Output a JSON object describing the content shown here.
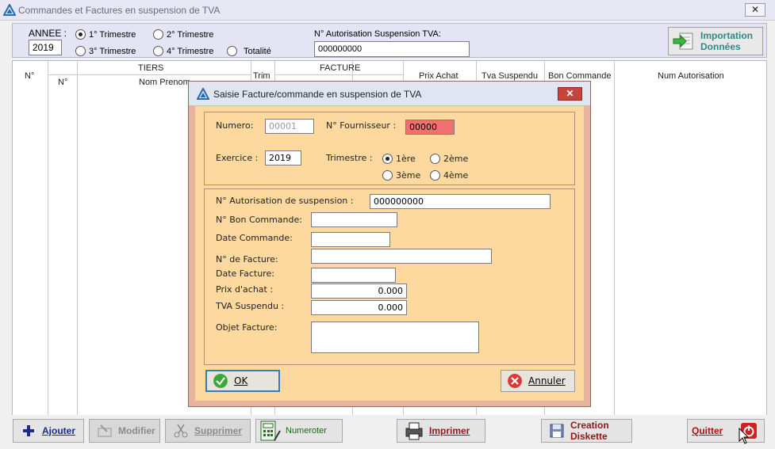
{
  "window": {
    "title": "Commandes et Factures en suspension de TVA",
    "close": "✕"
  },
  "filters": {
    "annee_label": "ANNEE :",
    "annee_value": "2019",
    "trimestres": [
      {
        "label": "1° Trimestre",
        "checked": true
      },
      {
        "label": "2° Trimestre",
        "checked": false
      },
      {
        "label": "3° Trimestre",
        "checked": false
      },
      {
        "label": "4° Trimestre",
        "checked": false
      },
      {
        "label": "Totalité",
        "checked": false
      }
    ],
    "auth_label": "N° Autorisation Suspension TVA:",
    "auth_value": "000000000",
    "import_line1": "Importation",
    "import_line2": "Données"
  },
  "grid": {
    "headers": {
      "num": "N°",
      "tiers": "TIERS",
      "tiers_num": "N°",
      "tiers_name": "Nom Prenom",
      "trim": "Trim",
      "facture": "FACTURE",
      "prix_achat": "Prix Achat",
      "tva_suspendu": "Tva Suspendu",
      "bon_commande": "Bon Commande",
      "num_autorisation": "Num Autorisation"
    }
  },
  "toolbar": {
    "ajouter": "Ajouter",
    "modifier": "Modifier",
    "supprimer": "Supprimer",
    "numeroter": "Numeroter",
    "imprimer": "Imprimer",
    "creation_line1": "Creation",
    "creation_line2": "Diskette",
    "quitter": "Quitter"
  },
  "dialog": {
    "title": "Saisie Facture/commande en suspension de TVA",
    "close": "✕",
    "numero_label": "Numero:",
    "numero_value": "00001",
    "fournisseur_label": "N° Fournisseur :",
    "fournisseur_value": "00000",
    "exercice_label": "Exercice  :",
    "exercice_value": "2019",
    "trimestre_label": "Trimestre :",
    "trimestres": [
      {
        "label": "1ère",
        "checked": true
      },
      {
        "label": "2ème",
        "checked": false
      },
      {
        "label": "3ème",
        "checked": false
      },
      {
        "label": "4ème",
        "checked": false
      }
    ],
    "autorisation_label": "N° Autorisation de suspension :",
    "autorisation_value": "000000000",
    "bon_commande_label": "N° Bon Commande:",
    "bon_commande_value": "",
    "date_commande_label": "Date Commande:",
    "date_commande_value": "",
    "facture_label": "N° de  Facture:",
    "facture_value": "",
    "date_facture_label": "Date Facture:",
    "date_facture_value": "",
    "prix_achat_label": "Prix d'achat :",
    "prix_achat_value": "0.000",
    "tva_label": "TVA Suspendu :",
    "tva_value": "0.000",
    "objet_label": "Objet Facture:",
    "objet_value": "",
    "ok": "OK",
    "annuler": "Annuler"
  },
  "colors": {
    "dialog_body": "#fdd9a0",
    "dialog_frame": "#e8b4a0",
    "fournisseur_bg": "#f07070",
    "import_text": "#2e8a8a",
    "filters_bg": "#e4e4f4"
  }
}
